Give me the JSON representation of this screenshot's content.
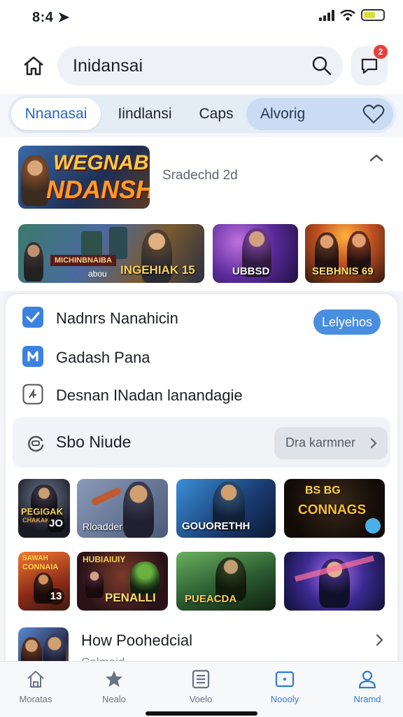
{
  "status_bar": {
    "time": "8:4 ➤"
  },
  "header": {
    "search_value": "Inidansai",
    "chat_badge": "2"
  },
  "tabs": [
    {
      "label": "Nnanasai",
      "state": "active"
    },
    {
      "label": "Iindlansi",
      "state": "normal"
    },
    {
      "label": "Caps",
      "state": "normal"
    },
    {
      "label": "Alvorig",
      "state": "highlight"
    }
  ],
  "featured": {
    "logo_line1": "WEGNABT",
    "logo_line2": "NDANSH",
    "subtitle": "Sradechd 2d",
    "banners": [
      {
        "label": "INGEHIAK 15",
        "sub": "MICHINBNAIBA",
        "caption": "abou"
      },
      {
        "label": "UBBSD"
      },
      {
        "label": "SEBHNIS 69"
      }
    ]
  },
  "list": {
    "items": [
      {
        "label": "Nadnrs Nanahicin",
        "icon": "checkbox-checked-icon",
        "button": "Lelyehos"
      },
      {
        "label": "Gadash Pana",
        "icon": "app-arrow-icon"
      },
      {
        "label": "Desnan INadan lanandagie",
        "icon": "outline-app-icon"
      }
    ]
  },
  "subsection": {
    "title": "Sbo Niude",
    "button": "Dra karmner"
  },
  "grid": [
    {
      "label": "PEGIGAK",
      "sub": "CHAKAK",
      "num": "JO"
    },
    {
      "label": "Rloadder"
    },
    {
      "label": "GOUORETHH"
    },
    {
      "label": "CONNAGS",
      "sub": "BS BG"
    },
    {
      "label": "CONNAIA",
      "sub": "SAWAH",
      "num": "13"
    },
    {
      "label": "PENALLI",
      "sub": "HUBIAIUIY"
    },
    {
      "label": "PUEACDA"
    },
    {
      "label": ""
    }
  ],
  "last_item": {
    "title": "How Poohedcial",
    "sub": "Calmaid"
  },
  "bottom_nav": [
    {
      "label": "Moratas",
      "icon": "home-icon"
    },
    {
      "label": "Nealo",
      "icon": "star-icon"
    },
    {
      "label": "Voelo",
      "icon": "list-icon"
    },
    {
      "label": "Noooly",
      "icon": "window-icon",
      "active": true
    },
    {
      "label": "Nramd",
      "icon": "user-icon",
      "active": true
    }
  ],
  "colors": {
    "accent": "#2f7bd6",
    "badge": "#e8403a",
    "button": "#4a8ee0"
  }
}
